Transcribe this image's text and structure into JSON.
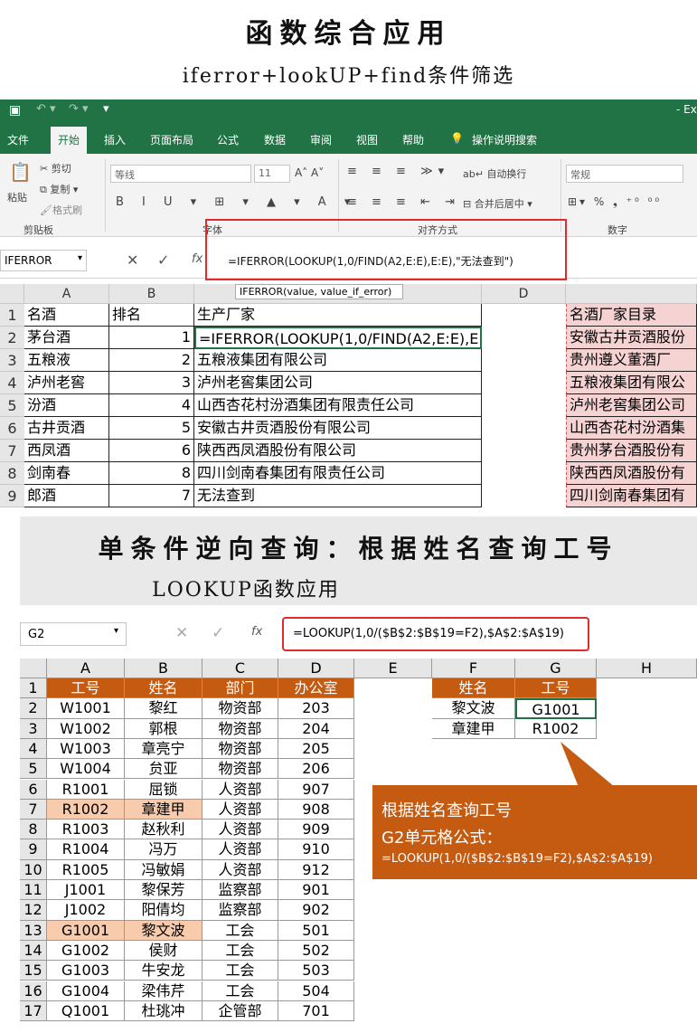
{
  "header": {
    "title": "函数综合应用",
    "subtitle": "iferror+lookUP+find条件筛选"
  },
  "excel1": {
    "title_right": "- Ex",
    "tabs": [
      "文件",
      "开始",
      "插入",
      "页面布局",
      "公式",
      "数据",
      "审阅",
      "视图",
      "帮助",
      "操作说明搜索"
    ],
    "ribbon": {
      "cut": "剪切",
      "copy": "复制",
      "paste": "粘贴",
      "format_painter": "格式刷",
      "clipboard": "剪贴板",
      "font_name": "等线",
      "font_size": "11",
      "font_group": "字体",
      "wrap": "自动换行",
      "merge": "合并后居中",
      "align_group": "对齐方式",
      "number_format": "常规",
      "number_group": "数字"
    },
    "name_box": "IFERROR",
    "formula": "=IFERROR(LOOKUP(1,0/FIND(A2,E:E),E:E),\"无法查到\")",
    "tooltip": "IFERROR(value, value_if_error)",
    "cols": [
      "A",
      "B",
      "C",
      "D"
    ],
    "rows": [
      {
        "n": "1",
        "a": "名酒",
        "b": "排名",
        "c": "生产厂家",
        "e": "名酒厂家目录"
      },
      {
        "n": "2",
        "a": "茅台酒",
        "b": "1",
        "c": "=IFERROR(LOOKUP(1,0/FIND(A2,E:E),E",
        "e": "安徽古井贡酒股份"
      },
      {
        "n": "3",
        "a": "五粮液",
        "b": "2",
        "c": "五粮液集团有限公司",
        "e": "贵州遵义董酒厂"
      },
      {
        "n": "4",
        "a": "泸州老窖",
        "b": "3",
        "c": "泸州老窖集团公司",
        "e": "五粮液集团有限公"
      },
      {
        "n": "5",
        "a": "汾酒",
        "b": "4",
        "c": "山西杏花村汾酒集团有限责任公司",
        "e": "泸州老窖集团公司"
      },
      {
        "n": "6",
        "a": "古井贡酒",
        "b": "5",
        "c": "安徽古井贡酒股份有限公司",
        "e": "山西杏花村汾酒集"
      },
      {
        "n": "7",
        "a": "西凤酒",
        "b": "6",
        "c": "陕西西凤酒股份有限公司",
        "e": "贵州茅台酒股份有"
      },
      {
        "n": "8",
        "a": "剑南春",
        "b": "8",
        "c": "四川剑南春集团有限责任公司",
        "e": "陕西西凤酒股份有"
      },
      {
        "n": "9",
        "a": "郎酒",
        "b": "7",
        "c": "无法查到",
        "e": "四川剑南春集团有"
      }
    ]
  },
  "section2": {
    "title": "单条件逆向查询：根据姓名查询工号",
    "subtitle": "LOOKUP函数应用"
  },
  "excel2": {
    "name_box": "G2",
    "formula": "=LOOKUP(1,0/($B$2:$B$19=F2),$A$2:$A$19)",
    "cols": [
      "A",
      "B",
      "C",
      "D",
      "E",
      "F",
      "G",
      "H"
    ],
    "headers": [
      "工号",
      "姓名",
      "部门",
      "办公室"
    ],
    "rows": [
      {
        "n": "2",
        "id": "W1001",
        "name": "黎红",
        "dept": "物资部",
        "office": "203"
      },
      {
        "n": "3",
        "id": "W1002",
        "name": "郭根",
        "dept": "物资部",
        "office": "204"
      },
      {
        "n": "4",
        "id": "W1003",
        "name": "章亮宁",
        "dept": "物资部",
        "office": "205"
      },
      {
        "n": "5",
        "id": "W1004",
        "name": "贠亚",
        "dept": "物资部",
        "office": "206"
      },
      {
        "n": "6",
        "id": "R1001",
        "name": "屈锁",
        "dept": "人资部",
        "office": "907"
      },
      {
        "n": "7",
        "id": "R1002",
        "name": "章建甲",
        "dept": "人资部",
        "office": "908"
      },
      {
        "n": "8",
        "id": "R1003",
        "name": "赵秋利",
        "dept": "人资部",
        "office": "909"
      },
      {
        "n": "9",
        "id": "R1004",
        "name": "冯万",
        "dept": "人资部",
        "office": "910"
      },
      {
        "n": "10",
        "id": "R1005",
        "name": "冯敏娟",
        "dept": "人资部",
        "office": "912"
      },
      {
        "n": "11",
        "id": "J1001",
        "name": "黎保芳",
        "dept": "监察部",
        "office": "901"
      },
      {
        "n": "12",
        "id": "J1002",
        "name": "阳倩均",
        "dept": "监察部",
        "office": "902"
      },
      {
        "n": "13",
        "id": "G1001",
        "name": "黎文波",
        "dept": "工会",
        "office": "501"
      },
      {
        "n": "14",
        "id": "G1002",
        "name": "侯财",
        "dept": "工会",
        "office": "502"
      },
      {
        "n": "15",
        "id": "G1003",
        "name": "牛安龙",
        "dept": "工会",
        "office": "503"
      },
      {
        "n": "16",
        "id": "G1004",
        "name": "梁伟芹",
        "dept": "工会",
        "office": "504"
      },
      {
        "n": "17",
        "id": "Q1001",
        "name": "杜珧冲",
        "dept": "企管部",
        "office": "701"
      }
    ],
    "lookup": {
      "h_name": "姓名",
      "h_id": "工号",
      "r1_name": "黎文波",
      "r1_id": "G1001",
      "r2_name": "章建甲",
      "r2_id": "R1002"
    },
    "callout": {
      "line1": "根据姓名查询工号",
      "line2": "G2单元格公式：",
      "line3": "=LOOKUP(1,0/($B$2:$B$19=F2),$A$2:$A$19)"
    }
  }
}
